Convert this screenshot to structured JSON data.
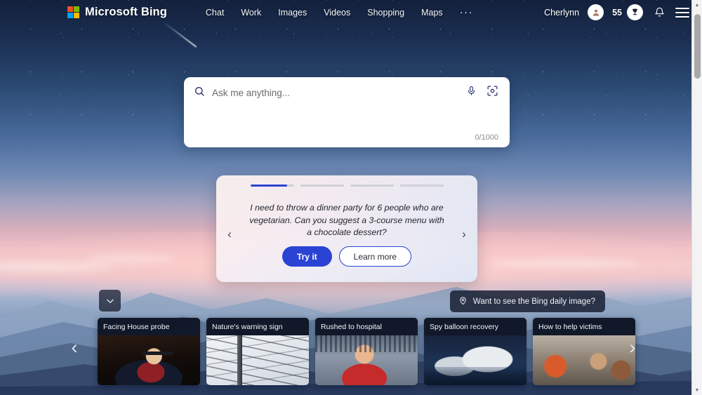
{
  "header": {
    "brand": "Microsoft Bing",
    "logo_colors": {
      "tl": "#f25022",
      "tr": "#7fba00",
      "bl": "#00a4ef",
      "br": "#ffb900"
    },
    "nav": [
      {
        "label": "Chat"
      },
      {
        "label": "Work"
      },
      {
        "label": "Images"
      },
      {
        "label": "Videos"
      },
      {
        "label": "Shopping"
      },
      {
        "label": "Maps"
      }
    ],
    "more_label": "···",
    "user_name": "Cherlynn",
    "rewards_count": "55"
  },
  "search": {
    "value": "",
    "placeholder": "Ask me anything...",
    "counter": "0/1000"
  },
  "suggestion": {
    "progress": [
      {
        "fill": 85
      },
      {
        "fill": 0
      },
      {
        "fill": 0
      },
      {
        "fill": 0
      }
    ],
    "text": "I need to throw a dinner party for 6 people who are vegetarian. Can you suggest a 3-course menu with a chocolate dessert?",
    "try_label": "Try it",
    "learn_label": "Learn more",
    "prev_glyph": "‹",
    "next_glyph": "›",
    "accent_color": "#2b43d4"
  },
  "daily_image": {
    "label": "Want to see the Bing daily image?"
  },
  "carousel": {
    "prev_glyph": "‹",
    "next_glyph": "›",
    "cards": [
      {
        "headline": "Facing House probe"
      },
      {
        "headline": "Nature's warning sign"
      },
      {
        "headline": "Rushed to hospital"
      },
      {
        "headline": "Spy balloon recovery"
      },
      {
        "headline": "How to help victims"
      }
    ]
  },
  "scrollbar": {
    "up_glyph": "▲",
    "down_glyph": "▼"
  }
}
